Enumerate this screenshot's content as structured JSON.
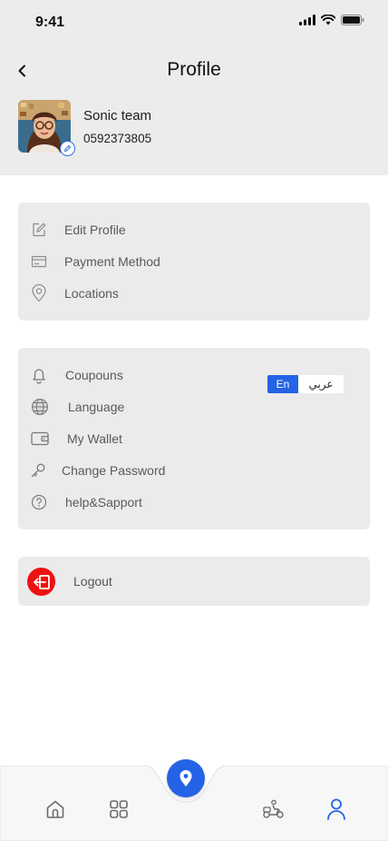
{
  "status_bar": {
    "time": "9:41"
  },
  "header": {
    "title": "Profile"
  },
  "profile": {
    "name": "Sonic team",
    "phone": "0592373805"
  },
  "account_menu": [
    {
      "label": "Edit Profile",
      "icon": "edit-icon"
    },
    {
      "label": "Payment Method",
      "icon": "card-icon"
    },
    {
      "label": "Locations",
      "icon": "location-pin-icon"
    }
  ],
  "settings_menu": [
    {
      "label": "Coupouns",
      "icon": "bell-icon"
    },
    {
      "label": "Language",
      "icon": "globe-icon"
    },
    {
      "label": "My Wallet",
      "icon": "wallet-icon"
    },
    {
      "label": "Change Password",
      "icon": "key-icon"
    },
    {
      "label": "help&Sapport",
      "icon": "help-icon"
    }
  ],
  "language_toggle": {
    "english": "En",
    "arabic": "عربي",
    "selected": "En"
  },
  "logout": {
    "label": "Logout",
    "icon": "logout-icon"
  },
  "bottom_nav": {
    "items": [
      "home-icon",
      "grid-icon",
      "location-pin-icon",
      "delivery-scooter-icon",
      "user-icon"
    ],
    "active": "user-icon"
  },
  "colors": {
    "accent": "#2463e6",
    "danger": "#ee1111",
    "header_background": "#ececec",
    "card_background": "#ebebeb",
    "label_text": "#5a5a5a"
  }
}
